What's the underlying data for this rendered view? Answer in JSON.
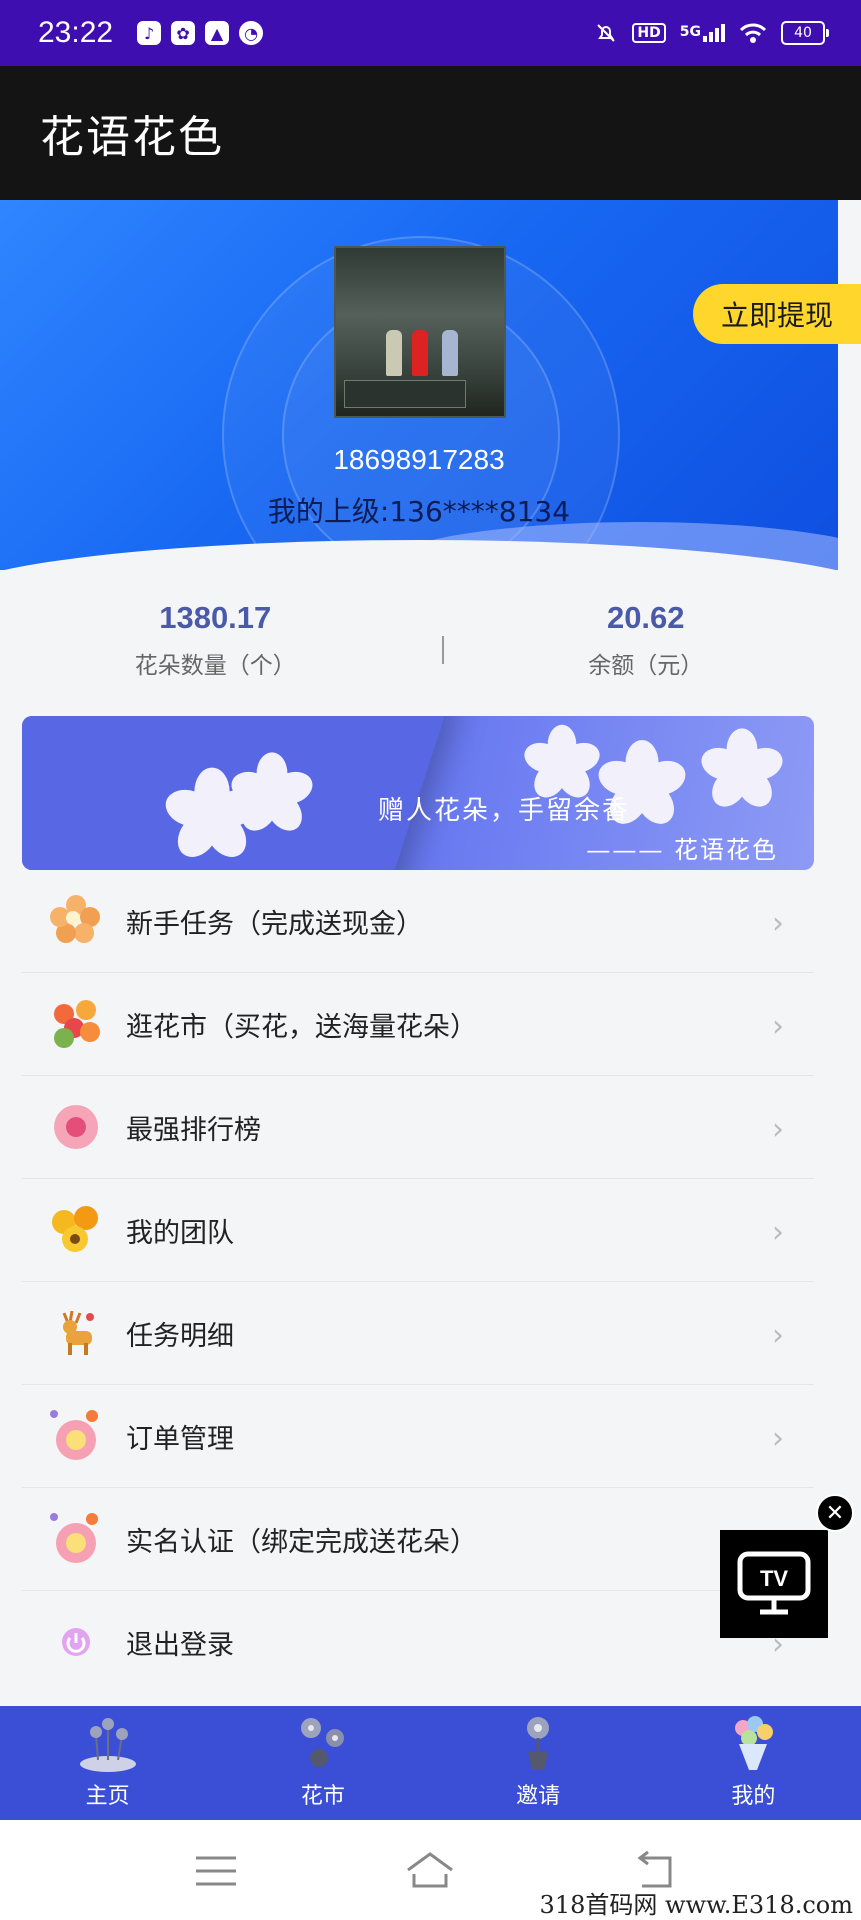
{
  "status_bar": {
    "time": "23:22",
    "network": "5G",
    "hd": "HD",
    "battery": "40"
  },
  "app_bar": {
    "title": "花语花色"
  },
  "profile": {
    "phone": "18698917283",
    "superior": "我的上级:136****8134",
    "withdraw_label": "立即提现"
  },
  "stats": [
    {
      "value": "1380.17",
      "label": "花朵数量（个）"
    },
    {
      "value": "20.62",
      "label": "余额（元）"
    }
  ],
  "banner": {
    "slogan": "赠人花朵，手留余香",
    "signature": "——— 花语花色"
  },
  "menu": [
    {
      "label": "新手任务（完成送现金）",
      "icon": "orange-flower-icon"
    },
    {
      "label": "逛花市（买花，送海量花朵）",
      "icon": "flower-bouquet-icon"
    },
    {
      "label": "最强排行榜",
      "icon": "pink-flower-icon"
    },
    {
      "label": "我的团队",
      "icon": "yellow-flowers-icon"
    },
    {
      "label": "任务明细",
      "icon": "deer-icon"
    },
    {
      "label": "订单管理",
      "icon": "smiling-flower-icon"
    },
    {
      "label": "实名认证（绑定完成送花朵）",
      "icon": "smiling-flower-icon"
    },
    {
      "label": "退出登录",
      "icon": "power-icon"
    }
  ],
  "tabs": [
    {
      "label": "主页",
      "icon": "home-flowers-icon"
    },
    {
      "label": "花市",
      "icon": "flower-market-icon"
    },
    {
      "label": "邀请",
      "icon": "potted-flower-icon"
    },
    {
      "label": "我的",
      "icon": "bouquet-icon"
    }
  ],
  "floating": {
    "tv_label": "TV"
  },
  "watermark": "318首码网 www.E318.com",
  "colors": {
    "status_bar": "#3f0eb0",
    "app_bar": "#141414",
    "hero": "#1868f2",
    "accent_yellow": "#ffd62b",
    "stat_value": "#4b5aa8",
    "tabbar": "#3a4fd6"
  }
}
